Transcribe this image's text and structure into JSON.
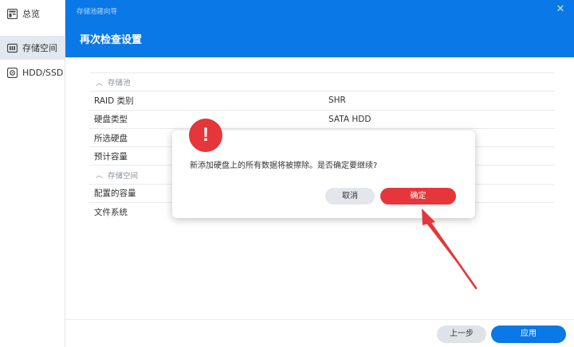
{
  "sidebar": {
    "items": [
      {
        "label": "总览",
        "icon": "overview-icon"
      },
      {
        "label": "存储空间",
        "icon": "storage-icon"
      },
      {
        "label": "HDD/SSD",
        "icon": "disk-icon"
      }
    ],
    "active_index": 1
  },
  "wizard": {
    "caption": "存储池建向导",
    "title": "再次检查设置",
    "sections": [
      {
        "label": "存储池",
        "rows": [
          {
            "key": "RAID 类别",
            "value": "SHR"
          },
          {
            "key": "硬盘类型",
            "value": "SATA HDD"
          },
          {
            "key": "所选硬盘",
            "value": ""
          },
          {
            "key": "预计容量",
            "value": ""
          }
        ]
      },
      {
        "label": "存储空间",
        "rows": [
          {
            "key": "配置的容量",
            "value": ""
          },
          {
            "key": "文件系统",
            "value": ""
          }
        ]
      }
    ],
    "back_label": "上一步",
    "apply_label": "应用"
  },
  "dialog": {
    "icon": "alert-icon",
    "badge": "!",
    "message": "新添加硬盘上的所有数据将被擦除。是否确定要继续?",
    "cancel_label": "取消",
    "ok_label": "确定"
  },
  "colors": {
    "primary": "#0a78e6",
    "danger": "#e5363b",
    "sidebar_active": "#e3e8ee"
  }
}
